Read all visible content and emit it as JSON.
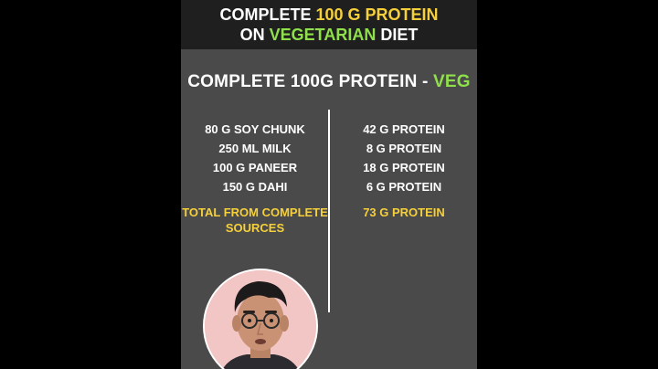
{
  "header": {
    "line1_prefix": "COMPLETE ",
    "line1_highlight": "100 G PROTEIN",
    "line2_prefix": "ON ",
    "line2_highlight": "VEGETARIAN",
    "line2_suffix": " DIET"
  },
  "subtitle": {
    "main": "COMPLETE 100G PROTEIN - ",
    "highlight": "VEG"
  },
  "rows": [
    {
      "item": "80 G SOY CHUNK",
      "protein": "42 G PROTEIN"
    },
    {
      "item": "250 ML MILK",
      "protein": "8 G PROTEIN"
    },
    {
      "item": "100 G PANEER",
      "protein": "18 G PROTEIN"
    },
    {
      "item": "150 G DAHI",
      "protein": "6 G PROTEIN"
    }
  ],
  "total": {
    "label": "TOTAL FROM COMPLETE SOURCES",
    "value": "73 G PROTEIN"
  },
  "colors": {
    "background": "#000000",
    "panel": "#4a4a4a",
    "header_bar": "#1f1f1f",
    "yellow_accent": "#f5d03a",
    "green_accent": "#8fe04a",
    "avatar_bg": "#f3c6c6"
  }
}
